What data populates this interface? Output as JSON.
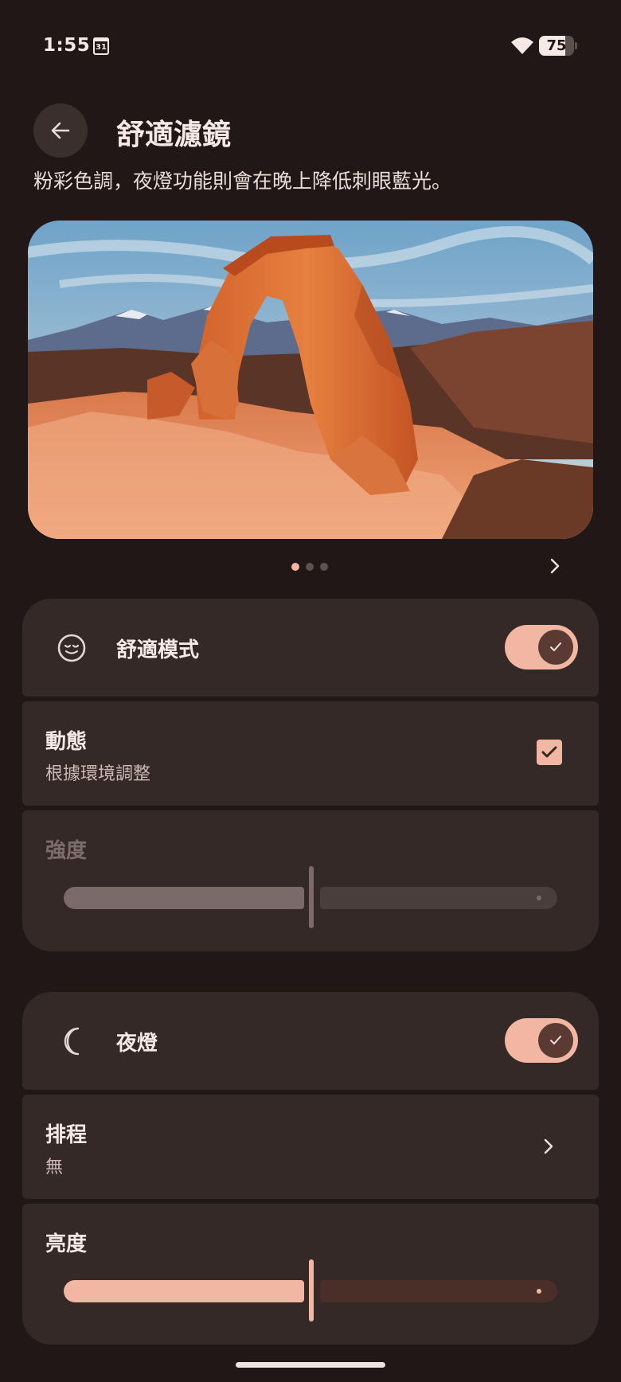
{
  "status_bar": {
    "time": "1:55",
    "calendar_day": "31",
    "battery_percent": "75",
    "battery_level": 0.75,
    "icons": [
      "calendar-icon",
      "wifi-icon",
      "battery-icon"
    ]
  },
  "header": {
    "title": "舒適濾鏡",
    "back_icon": "arrow-left-icon"
  },
  "description": "粉彩色調，夜燈功能則會在晚上降低刺眼藍光。",
  "carousel": {
    "page_count": 3,
    "active_index": 0,
    "next_icon": "chevron-right-icon"
  },
  "comfort_section": {
    "mode_label": "舒適模式",
    "mode_icon": "smile-face-icon",
    "mode_enabled": true,
    "dynamic": {
      "label": "動態",
      "summary": "根據環境調整",
      "checked": true
    },
    "intensity": {
      "label": "強度",
      "value": 0.5,
      "enabled": false
    }
  },
  "night_section": {
    "label": "夜燈",
    "icon": "moon-icon",
    "enabled": true,
    "schedule": {
      "label": "排程",
      "value": "無"
    },
    "brightness": {
      "label": "亮度",
      "value": 0.5,
      "enabled": true
    }
  },
  "colors": {
    "background": "#201716",
    "card": "#342927",
    "accent": "#f2b7a3",
    "toggle_knob": "#5b3a33",
    "disabled_slider": "#7a6b69"
  }
}
